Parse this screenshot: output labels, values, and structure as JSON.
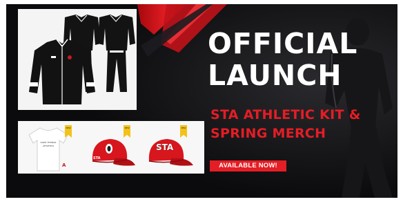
{
  "headline": {
    "line1": "OFFICIAL",
    "line2": "LAUNCH"
  },
  "subhead": {
    "line1": "STA ATHLETIC KIT &",
    "line2": "SPRING MERCH"
  },
  "cta": {
    "label": "AVAILABLE NOW!"
  },
  "merch": {
    "badges": [
      "NEW",
      "NEW",
      "NEW"
    ],
    "tee_print_line1": "SAINT THOMAS",
    "tee_print_line2": "ATHLETICS",
    "cap_text": "STA"
  },
  "colors": {
    "background": "#0d0d0f",
    "accent_red": "#e51d24",
    "badge_yellow": "#f3c21a",
    "headline_white": "#ffffff"
  },
  "icons": [
    "jacket-icon",
    "tracksuit-icon",
    "tshirt-icon",
    "cap-icon"
  ]
}
